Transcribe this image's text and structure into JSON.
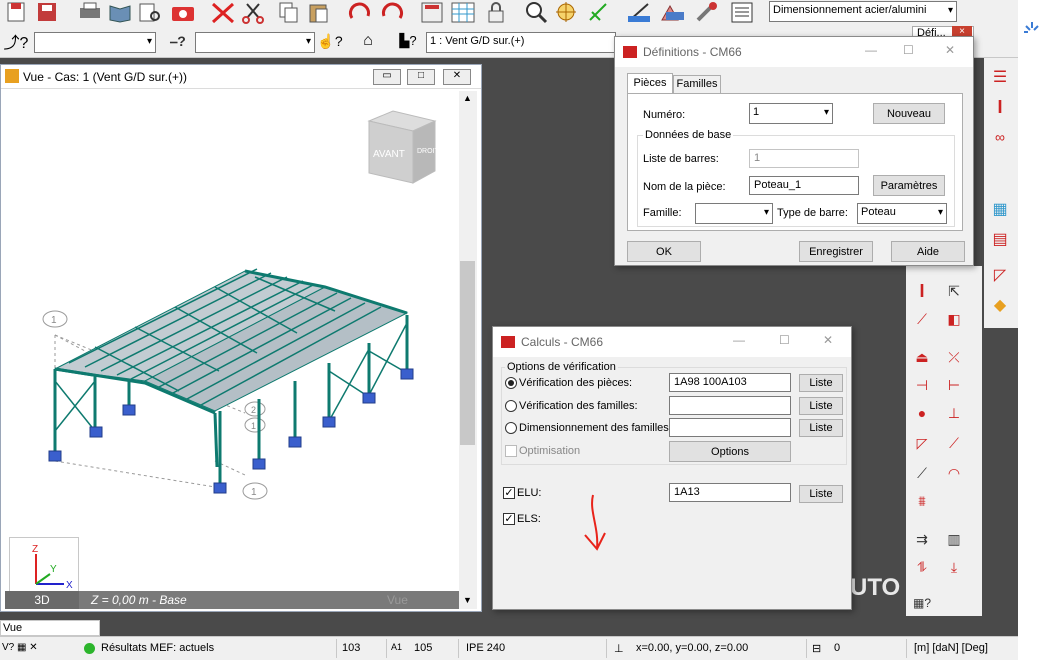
{
  "toolbar": {
    "analysis_combo": "Dimensionnement acier/alumini",
    "defi_label": "Défi...",
    "load_case_combo": "1 : Vent G/D sur.(+)",
    "icons": [
      "new-file-icon",
      "save-icon",
      "print-icon",
      "open-book-icon",
      "preview-icon",
      "camera-icon",
      "delete-x-icon",
      "scissors-icon",
      "copy-icon",
      "paste-icon",
      "undo-icon",
      "redo-icon",
      "calculator-icon",
      "table-icon",
      "lock-icon",
      "zoom-icon",
      "target-icon",
      "axis-icon",
      "measure-icon",
      "structure-icon",
      "wrench-icon",
      "report-icon"
    ]
  },
  "view": {
    "title": "Vue - Cas: 1 (Vent G/D sur.(+))",
    "cube_front": "AVANT",
    "cube_right": "DROITE",
    "mode": "3D",
    "level_label": "Z = 0,00 m - Base",
    "vue_ghost": "Vue",
    "axis_labels": {
      "z": "Z",
      "y": "Y",
      "x": "X"
    },
    "grid_labels": [
      "1",
      "1",
      "2",
      "1"
    ]
  },
  "definitions_dialog": {
    "title": "Définitions - CM66",
    "tabs": [
      "Pièces",
      "Familles"
    ],
    "numero_label": "Numéro:",
    "numero_value": "1",
    "nouveau": "Nouveau",
    "group_label": "Données de base",
    "liste_barres_label": "Liste de barres:",
    "liste_barres_value": "1",
    "nom_piece_label": "Nom de la pièce:",
    "nom_piece_value": "Poteau_1",
    "parametres": "Paramètres",
    "famille_label": "Famille:",
    "famille_value": "",
    "type_barre_label": "Type de barre:",
    "type_barre_value": "Poteau",
    "ok": "OK",
    "enregistrer": "Enregistrer",
    "aide": "Aide"
  },
  "calculs_dialog": {
    "title": "Calculs - CM66",
    "group_label": "Options de vérification",
    "verif_pieces_label": "Vérification des pièces:",
    "verif_pieces_value": "1A98 100A103",
    "verif_familles_label": "Vérification des familles:",
    "verif_familles_value": "",
    "dim_familles_label": "Dimensionnement des familles:",
    "dim_familles_value": "",
    "liste": "Liste",
    "optimisation": "Optimisation",
    "options": "Options",
    "elu_label": "ELU:",
    "elu_value": "1A13",
    "els_label": "ELS:"
  },
  "background": {
    "brand_fragment": "UTO"
  },
  "vue_strip": "Vue",
  "statusbar": {
    "results": "Résultats MEF: actuels",
    "node_count": "103",
    "bar_count": "105",
    "section": "IPE 240",
    "coords": "x=0.00, y=0.00, z=0.00",
    "value": "0",
    "units": "[m] [daN] [Deg]"
  },
  "colors": {
    "steel": "#0e7a6f",
    "support": "#3a5fcd",
    "roof": "#b8c4cc",
    "red_annotation": "#e8231a"
  }
}
